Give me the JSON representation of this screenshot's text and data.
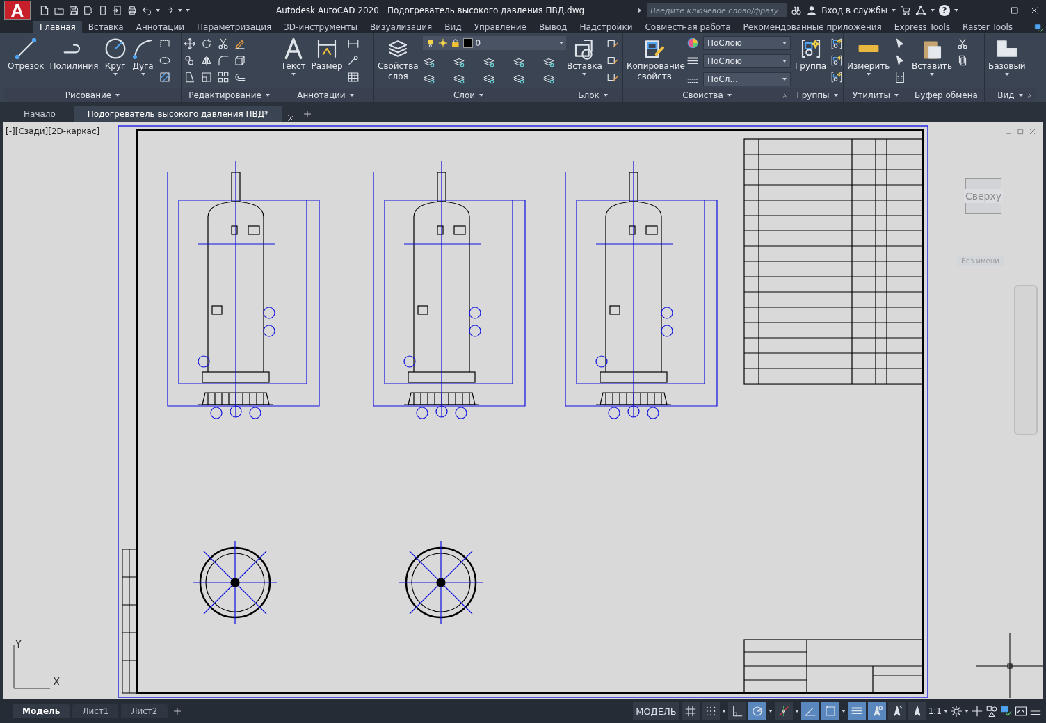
{
  "title_bar": {
    "logo_letter": "A",
    "app_name": "Autodesk AutoCAD 2020",
    "document": "Подогреватель высокого давления ПВД.dwg",
    "search": {
      "placeholder": "Введите ключевое слово/фразу"
    },
    "sign_in": "Вход в службы",
    "help": "?"
  },
  "ribbon_tabs": [
    {
      "label": "Главная",
      "selected": true
    },
    {
      "label": "Вставка",
      "selected": false
    },
    {
      "label": "Аннотации",
      "selected": false
    },
    {
      "label": "Параметризация",
      "selected": false
    },
    {
      "label": "3D-инструменты",
      "selected": false
    },
    {
      "label": "Визуализация",
      "selected": false
    },
    {
      "label": "Вид",
      "selected": false
    },
    {
      "label": "Управление",
      "selected": false
    },
    {
      "label": "Вывод",
      "selected": false
    },
    {
      "label": "Надстройки",
      "selected": false
    },
    {
      "label": "Совместная работа",
      "selected": false
    },
    {
      "label": "Рекомендованные приложения",
      "selected": false
    },
    {
      "label": "Express Tools",
      "selected": false
    },
    {
      "label": "Raster Tools",
      "selected": false
    }
  ],
  "ribbon_panels": [
    {
      "title": "Рисование",
      "menu": true,
      "launcher": false,
      "buttons": [
        {
          "label": "Отрезок",
          "dropdown": false
        },
        {
          "label": "Полилиния",
          "dropdown": false
        },
        {
          "label": "Круг",
          "dropdown": true
        },
        {
          "label": "Дуга",
          "dropdown": true
        }
      ]
    },
    {
      "title": "Редактирование",
      "menu": true,
      "launcher": false
    },
    {
      "title": "Аннотации",
      "menu": true,
      "launcher": false,
      "buttons": [
        {
          "label": "Текст",
          "dropdown": true
        },
        {
          "label": "Размер",
          "dropdown": false
        }
      ]
    },
    {
      "title": "Слои",
      "menu": true,
      "launcher": false,
      "buttons": [
        {
          "label": "Свойства слоя",
          "dropdown": false
        }
      ],
      "layer": "0"
    },
    {
      "title": "Блок",
      "menu": true,
      "launcher": false,
      "buttons": [
        {
          "label": "Вставка",
          "dropdown": true
        }
      ]
    },
    {
      "title": "Свойства",
      "menu": true,
      "launcher": true,
      "buttons": [
        {
          "label": "Копирование свойств",
          "dropdown": false
        }
      ],
      "combos": [
        "ПоСлою",
        "ПоСлою",
        "ПоСл..."
      ]
    },
    {
      "title": "Группы",
      "menu": true,
      "launcher": false,
      "buttons": [
        {
          "label": "Группа",
          "dropdown": false
        }
      ]
    },
    {
      "title": "Утилиты",
      "menu": true,
      "launcher": false,
      "buttons": [
        {
          "label": "Измерить",
          "dropdown": true
        }
      ]
    },
    {
      "title": "Буфер обмена",
      "menu": false,
      "launcher": false,
      "buttons": [
        {
          "label": "Вставить",
          "dropdown": true
        }
      ]
    },
    {
      "title": "Вид",
      "menu": true,
      "launcher": true,
      "buttons": [
        {
          "label": "Базовый",
          "dropdown": true
        }
      ]
    }
  ],
  "file_tabs": [
    {
      "label": "Начало",
      "selected": false
    },
    {
      "label": "Подогреватель высокого давления ПВД*",
      "selected": true
    }
  ],
  "viewport": {
    "label": "[-][Сзади][2D-каркас]",
    "viewcube": "Сверху",
    "ucs_name": "Без имени",
    "axis_y": "Y",
    "axis_x": "X"
  },
  "layout_tabs": [
    {
      "label": "Модель",
      "selected": true
    },
    {
      "label": "Лист1",
      "selected": false
    },
    {
      "label": "Лист2",
      "selected": false
    }
  ],
  "status_bar": {
    "model": "МОДЕЛЬ",
    "scale": "1:1",
    "toggles": [
      {
        "kind": "grid",
        "on": false,
        "dropdown": false
      },
      {
        "kind": "snap",
        "on": false,
        "dropdown": true
      },
      {
        "kind": "ortho",
        "on": false,
        "dropdown": false
      },
      {
        "kind": "polar",
        "on": true,
        "dropdown": true
      },
      {
        "kind": "osnap",
        "on": false,
        "dropdown": true
      },
      {
        "kind": "angle",
        "on": true,
        "dropdown": false
      },
      {
        "kind": "dynamic",
        "on": true,
        "dropdown": true
      },
      {
        "kind": "lineweight",
        "on": true,
        "dropdown": false
      },
      {
        "kind": "annotation",
        "on": true,
        "dropdown": false
      },
      {
        "kind": "autoscale",
        "on": false,
        "dropdown": false
      },
      {
        "kind": "visibility",
        "on": false,
        "dropdown": false
      }
    ]
  }
}
